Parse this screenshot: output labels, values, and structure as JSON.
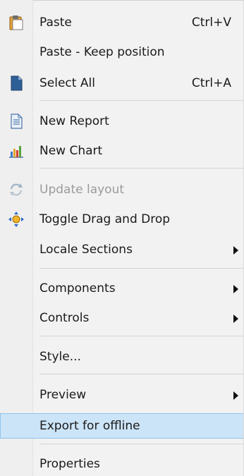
{
  "menu": {
    "items": [
      {
        "label": "Paste",
        "shortcut": "Ctrl+V",
        "icon": "clipboard-paste-icon"
      },
      {
        "label": "Paste - Keep position"
      },
      {
        "label": "Select All",
        "shortcut": "Ctrl+A",
        "icon": "document-select-all-icon"
      },
      {
        "label": "New Report",
        "icon": "new-report-document-icon"
      },
      {
        "label": "New Chart",
        "icon": "bar-chart-icon"
      },
      {
        "label": "Update layout",
        "icon": "refresh-layout-icon",
        "disabled": true
      },
      {
        "label": "Toggle Drag and Drop",
        "icon": "move-arrows-icon"
      },
      {
        "label": "Locale Sections",
        "submenu": true
      },
      {
        "label": "Components",
        "submenu": true
      },
      {
        "label": "Controls",
        "submenu": true
      },
      {
        "label": "Style..."
      },
      {
        "label": "Preview",
        "submenu": true
      },
      {
        "label": "Export for offline",
        "highlighted": true
      },
      {
        "label": "Properties"
      }
    ]
  },
  "colors": {
    "highlight_background": "#cce4f7",
    "highlight_border": "#8ec3ee",
    "disabled_text": "#9a9a9a",
    "menu_background": "#f2f2f2"
  }
}
